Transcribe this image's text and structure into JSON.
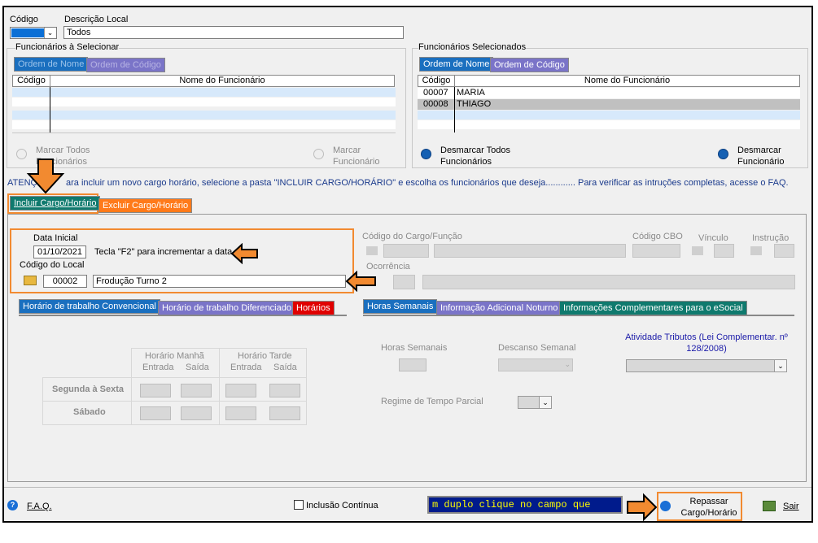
{
  "header": {
    "codigo_label": "Código",
    "descricao_label": "Descrição Local",
    "descricao_value": "Todos"
  },
  "left_panel": {
    "title": "Funcionários à Selecionar",
    "tab_nome": "Ordem de Nome",
    "tab_codigo": "Ordem de Código",
    "col_codigo": "Código",
    "col_nome": "Nome do Funcionário",
    "mark_all": "Marcar Todos Funcionários",
    "mark_one": "Marcar Funcionário"
  },
  "right_panel": {
    "title": "Funcionários Selecionados",
    "tab_nome": "Ordem de Nome",
    "tab_codigo": "Ordem de Código",
    "col_codigo": "Código",
    "col_nome": "Nome do Funcionário",
    "rows": [
      {
        "codigo": "00007",
        "nome": "MARIA"
      },
      {
        "codigo": "00008",
        "nome": "THIAGO"
      }
    ],
    "unmark_all": "Desmarcar Todos Funcionários",
    "unmark_one": "Desmarcar Funcionário"
  },
  "notice": {
    "left": "ATENÇ",
    "right": "ara incluir um novo cargo horário, selecione a pasta \"INCLUIR CARGO/HORÁRIO\" e escolha os funcionários que deseja............ Para verificar as intruções completas, acesse o FAQ."
  },
  "main_tabs": {
    "incluir": "Incluir Cargo/Horário",
    "excluir": "Excluir Cargo/Horário"
  },
  "form": {
    "data_inicial_label": "Data Inicial",
    "data_inicial_value": "01/10/2021",
    "tecla_hint": "Tecla \"F2\" para incrementar a data.",
    "codigo_local_label": "Código do Local",
    "codigo_local_value": "00002",
    "local_desc_value": "Frodução Turno 2",
    "cargo_label": "Código do Cargo/Função",
    "cbo_label": "Código CBO",
    "vinculo_label": "Vínculo",
    "instrucao_label": "Instrução",
    "ocorrencia_label": "Ocorrência"
  },
  "left_tabs": {
    "convencional": "Horário de trabalho Convencional",
    "diferenciado": "Horário de trabalho Diferenciado",
    "horarios": "Horários"
  },
  "right_tabs": {
    "semanais": "Horas Semanais",
    "noturno": "Informação Adicional Noturno",
    "esocial": "Informações Complementares para o eSocial"
  },
  "schedule": {
    "manha": "Horário Manhã",
    "tarde": "Horário Tarde",
    "entrada": "Entrada",
    "saida": "Saída",
    "seg_sex": "Segunda à Sexta",
    "sabado": "Sábado"
  },
  "horas": {
    "horas_semanais": "Horas Semanais",
    "descanso": "Descanso Semanal",
    "atividade": "Atividade Tributos (Lei Complementar. nº 128/2008)",
    "regime": "Regime de Tempo Parcial"
  },
  "footer": {
    "faq": "F.A.Q.",
    "inclusao": "Inclusão Contínua",
    "marquee": "m duplo clique no campo que",
    "repassar": "Repassar Cargo/Horário",
    "sair": "Sair"
  },
  "colors": {
    "tab_blue": "#1a6fbf",
    "tab_purple": "#7a74c8",
    "orange": "#f28a30",
    "marquee_bg": "#001b8c",
    "marquee_fg": "#ffff00"
  }
}
